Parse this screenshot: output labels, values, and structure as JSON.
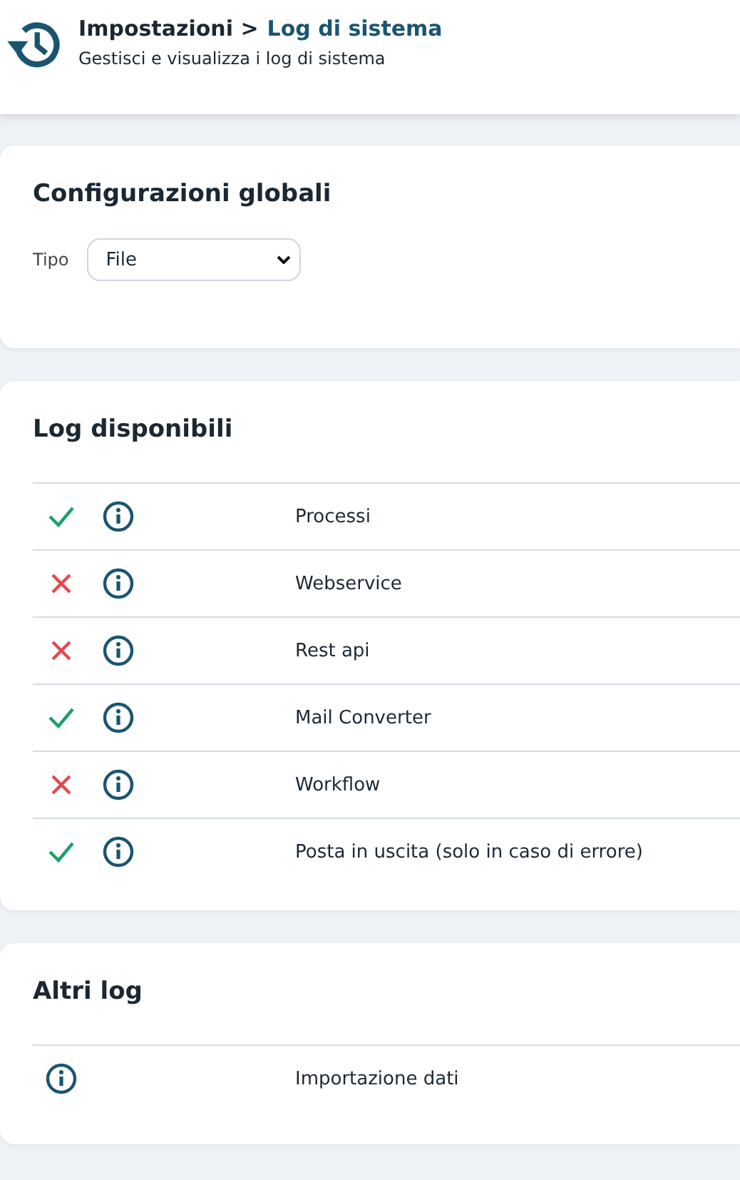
{
  "header": {
    "breadcrumb_parent": "Impostazioni >",
    "breadcrumb_current": "Log di sistema",
    "subtitle": "Gestisci e visualizza i log di sistema"
  },
  "global_config": {
    "title": "Configurazioni globali",
    "type_label": "Tipo",
    "type_value": "File"
  },
  "available_logs": {
    "title": "Log disponibili",
    "rows": [
      {
        "name": "Processi",
        "enabled": true
      },
      {
        "name": "Webservice",
        "enabled": false
      },
      {
        "name": "Rest api",
        "enabled": false
      },
      {
        "name": "Mail Converter",
        "enabled": true
      },
      {
        "name": "Workflow",
        "enabled": false
      },
      {
        "name": "Posta in uscita (solo in caso di errore)",
        "enabled": true
      }
    ]
  },
  "other_logs": {
    "title": "Altri log",
    "rows": [
      {
        "name": "Importazione dati"
      }
    ]
  }
}
